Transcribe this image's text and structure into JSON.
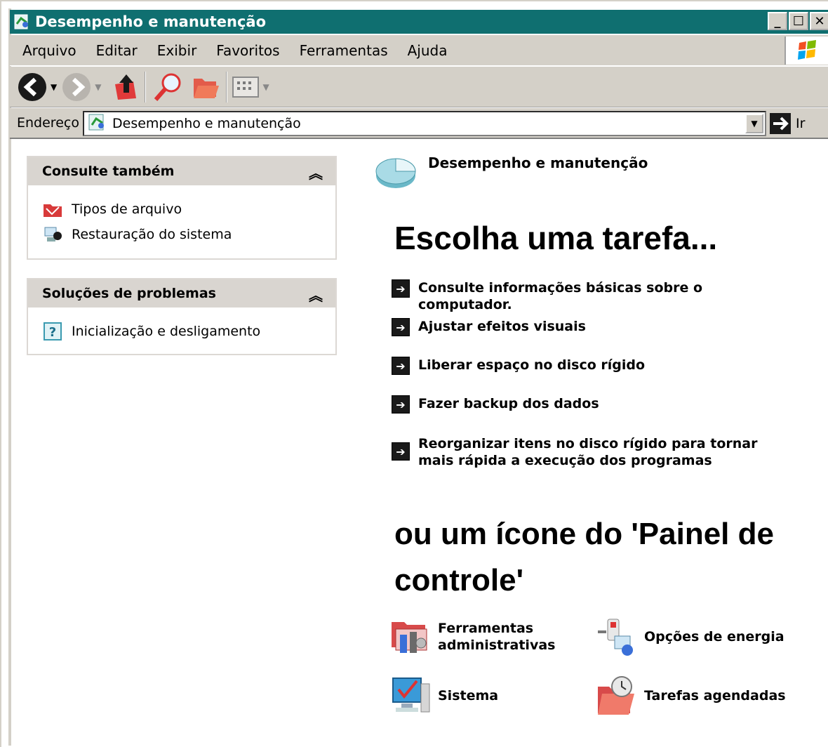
{
  "window": {
    "title": "Desempenho e manutenção",
    "controls": [
      "_",
      "☐",
      "✕"
    ]
  },
  "menu": {
    "items": [
      "Arquivo",
      "Editar",
      "Exibir",
      "Favoritos",
      "Ferramentas",
      "Ajuda"
    ]
  },
  "address": {
    "label": "Endereço",
    "value": "Desempenho e manutenção",
    "go_label": "Ir"
  },
  "sidebar": {
    "see_also": {
      "title": "Consulte também",
      "items": [
        {
          "label": "Tipos de arquivo",
          "icon": "file-types-icon"
        },
        {
          "label": "Restauração do sistema",
          "icon": "system-restore-icon"
        }
      ]
    },
    "troubleshoot": {
      "title": "Soluções de problemas",
      "items": [
        {
          "label": "Inicialização e desligamento",
          "icon": "help-icon"
        }
      ]
    }
  },
  "main": {
    "section_title": "Desempenho e manutenção",
    "choose_task": "Escolha uma tarefa...",
    "tasks": [
      "Consulte informações básicas sobre o computador.",
      "Ajustar efeitos visuais",
      "Liberar espaço no disco rígido",
      "Fazer backup dos dados",
      "Reorganizar itens no disco rígido para tornar mais rápida a execução dos programas"
    ],
    "or_icon": "ou um ícone do 'Painel de controle'",
    "control_panel_items": [
      {
        "label": "Ferramentas administrativas",
        "icon": "admin-tools-icon"
      },
      {
        "label": "Opções de energia",
        "icon": "power-options-icon"
      },
      {
        "label": "Sistema",
        "icon": "system-icon"
      },
      {
        "label": "Tarefas agendadas",
        "icon": "scheduled-tasks-icon"
      }
    ]
  },
  "colors": {
    "titlebar": "#0f6f70",
    "chrome": "#d4d0c8",
    "panel_header": "#d9d5d0"
  }
}
